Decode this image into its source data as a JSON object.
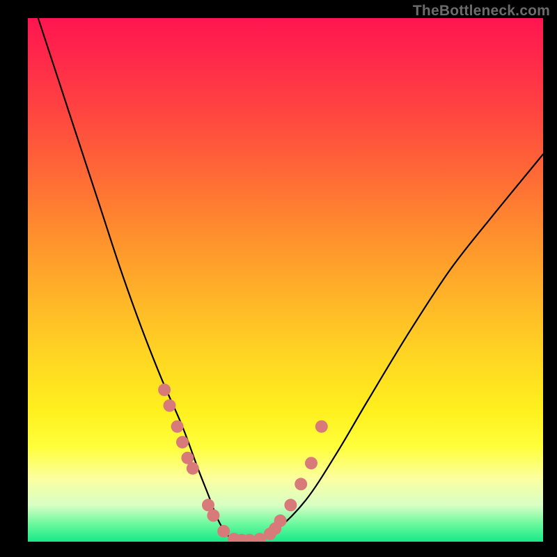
{
  "watermark": "TheBottleneck.com",
  "chart_data": {
    "type": "line",
    "title": "",
    "xlabel": "",
    "ylabel": "",
    "xlim": [
      0,
      100
    ],
    "ylim": [
      0,
      100
    ],
    "grid": false,
    "legend": false,
    "series": [
      {
        "name": "bottleneck-curve",
        "x": [
          2,
          6,
          10,
          14,
          18,
          22,
          26,
          30,
          33,
          35,
          37,
          39,
          41,
          44,
          48,
          54,
          60,
          66,
          74,
          82,
          90,
          100
        ],
        "y": [
          100,
          88,
          76,
          64,
          52,
          41,
          31,
          22,
          14,
          9,
          4,
          1,
          0,
          0,
          2,
          8,
          17,
          27,
          40,
          52,
          62,
          74
        ],
        "color": "#000000",
        "marker": false
      },
      {
        "name": "highlight-dots",
        "x": [
          26.5,
          27.5,
          29,
          30,
          31,
          32,
          35,
          36,
          38,
          40,
          41.5,
          43,
          45,
          47,
          48,
          49,
          51,
          53,
          55,
          57
        ],
        "y": [
          29,
          26,
          22,
          19,
          16,
          14,
          7,
          5,
          2,
          0.5,
          0.3,
          0.3,
          0.5,
          1.5,
          2.5,
          4,
          7,
          11,
          15,
          22
        ],
        "color": "#d97a7a",
        "marker": true
      }
    ],
    "background_gradient": {
      "top": "#ff1550",
      "middle": "#ffe81e",
      "bottom": "#18e888"
    }
  },
  "colors": {
    "page_bg": "#000000",
    "curve": "#000000",
    "dots": "#d97a7a",
    "watermark": "#6b6b6b"
  }
}
